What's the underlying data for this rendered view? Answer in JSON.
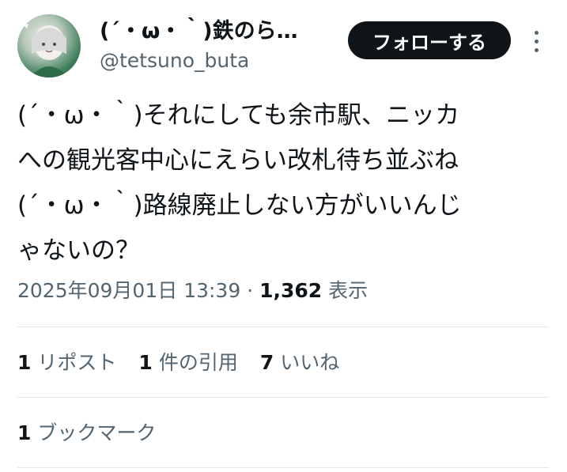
{
  "author": {
    "display_name": "(´・ω・｀)鉄のら…",
    "handle": "@tetsuno_buta"
  },
  "header": {
    "follow_label": "フォローする",
    "more_icon": "more-vertical-icon"
  },
  "tweet": {
    "lines": [
      "(´・ω・｀)それにしても余市駅、ニッカ",
      "への観光客中心にえらい改札待ち並ぶね",
      "(´・ω・｀)路線廃止しない方がいいんじ",
      "ゃないの？"
    ]
  },
  "meta": {
    "timestamp": "2025年09月01日 13:39",
    "separator": "·",
    "views_count": "1,362",
    "views_label": "表示"
  },
  "stats": {
    "reposts_count": "1",
    "reposts_label": "リポスト",
    "quotes_count": "1",
    "quotes_label": "件の引用",
    "likes_count": "7",
    "likes_label": "いいね",
    "bookmarks_count": "1",
    "bookmarks_label": "ブックマーク"
  },
  "colors": {
    "primary_text": "#0f1419",
    "secondary_text": "#536471",
    "divider": "#e3e7ea",
    "follow_bg": "#0f1419"
  }
}
